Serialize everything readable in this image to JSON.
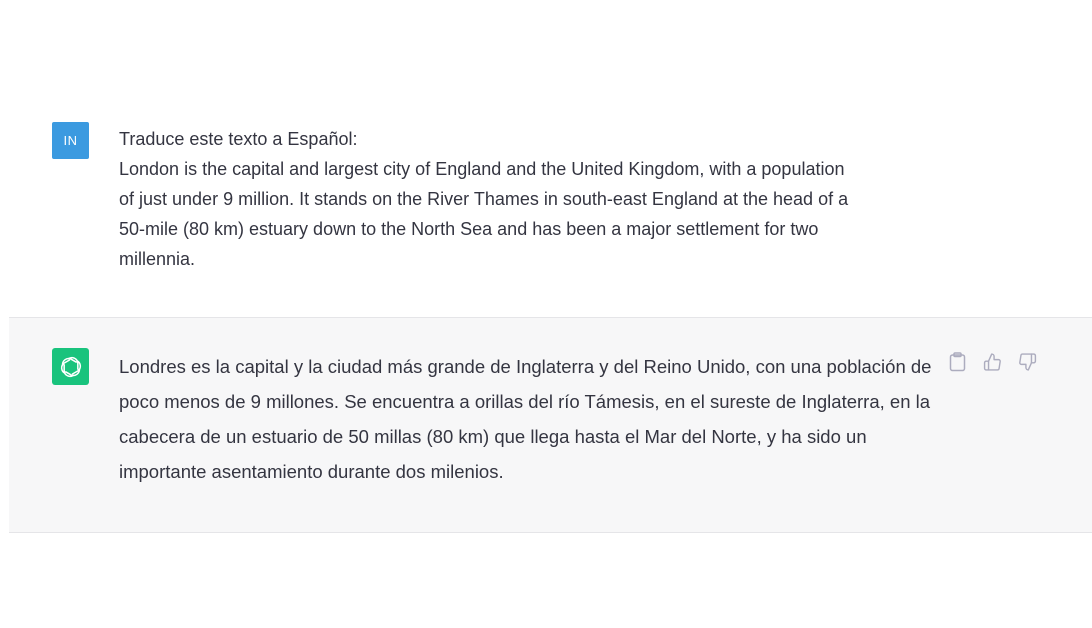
{
  "user_message": {
    "avatar_initials": "IN",
    "lines": [
      "Traduce este texto a Español:",
      "London is the capital and largest city of England and the United Kingdom, with a population",
      "of just under 9 million. It stands on the River Thames in south-east England at the head of a",
      "50-mile (80 km) estuary down to the North Sea and has been a major settlement for two",
      "millennia."
    ]
  },
  "assistant_message": {
    "avatar_icon": "openai-logo-icon",
    "text": "Londres es la capital y la ciudad más grande de Inglaterra y del Reino Unido, con una población de poco menos de 9 millones. Se encuentra a orillas del río Támesis, en el sureste de Inglaterra, en la cabecera de un estuario de 50 millas (80 km) que llega hasta el Mar del Norte, y ha sido un importante asentamiento durante dos milenios.",
    "actions": [
      "clipboard-icon",
      "thumbs-up-icon",
      "thumbs-down-icon"
    ]
  },
  "colors": {
    "user_avatar": "#3b9ae0",
    "assistant_avatar": "#19c37d",
    "assistant_bg": "#f7f7f8",
    "text": "#343541",
    "icon": "#acacbe"
  }
}
